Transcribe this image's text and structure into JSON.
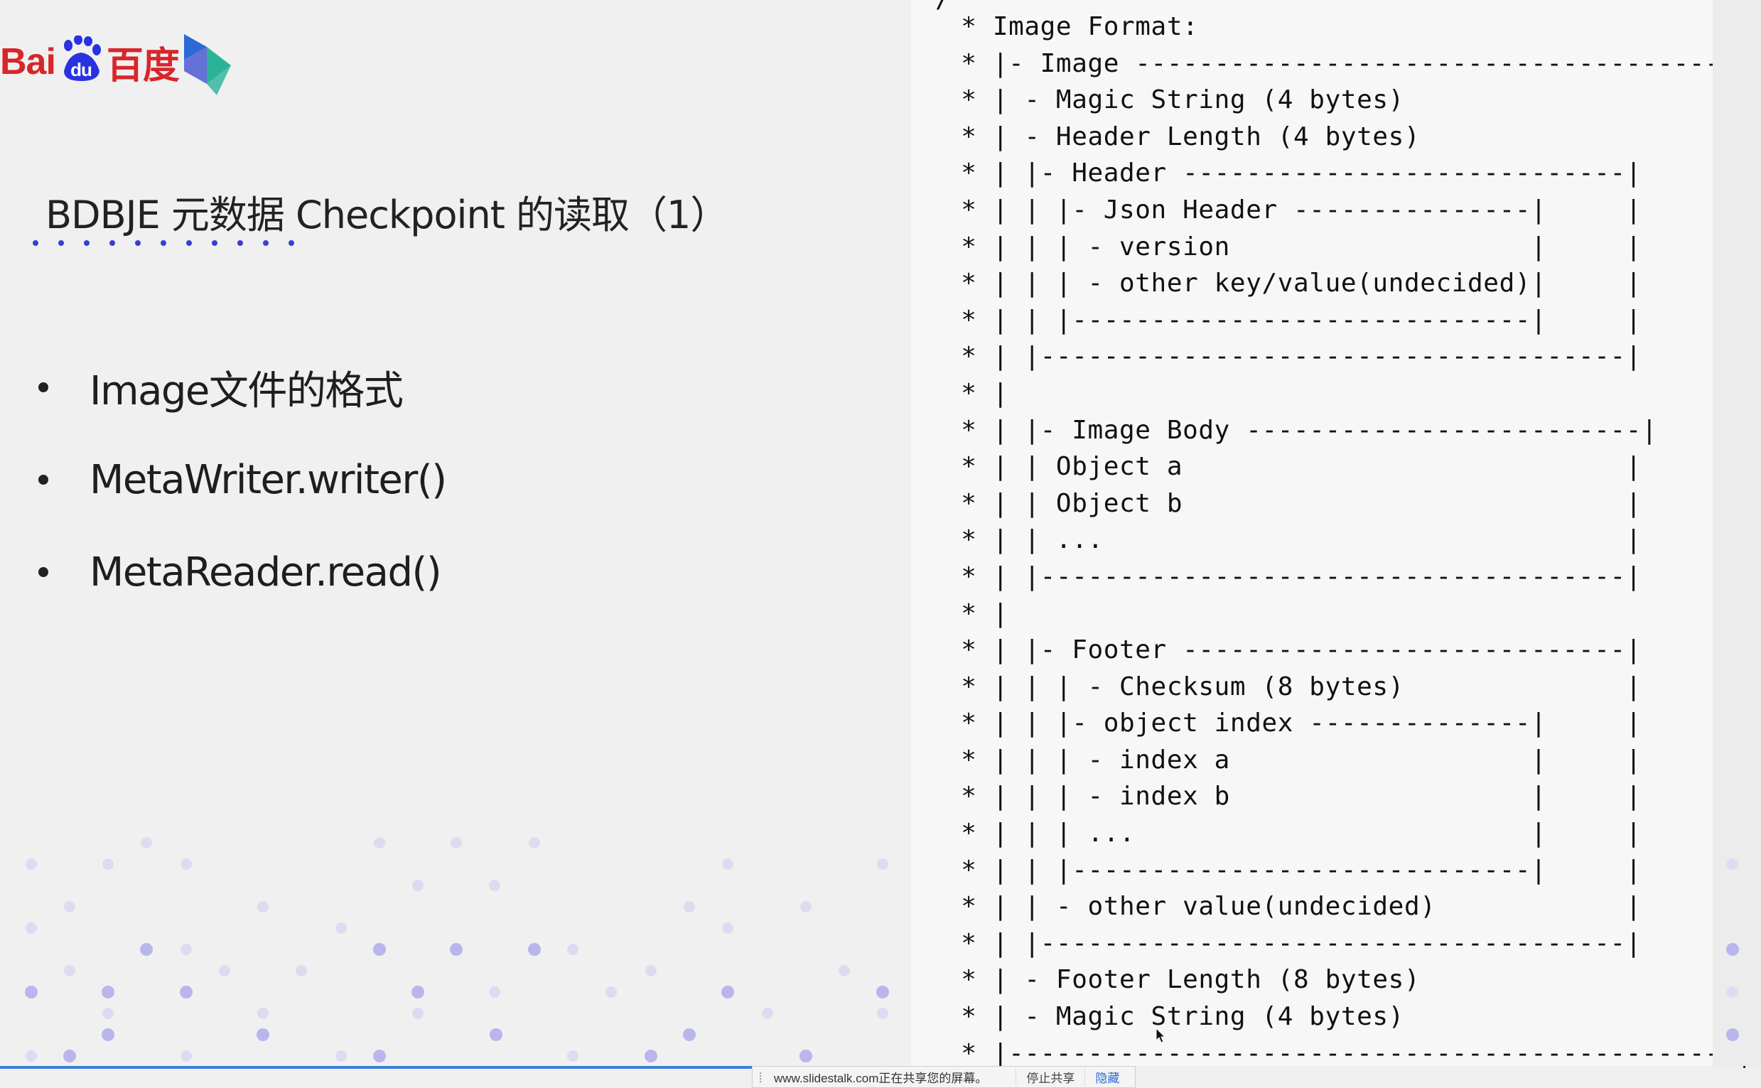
{
  "slide": {
    "brand": {
      "baidu_pre": "Bai",
      "baidu_du": "du",
      "baidu_cn": "百度"
    },
    "title": "BDBJE 元数据 Checkpoint 的读取（1）",
    "bullets": [
      "Image文件的格式",
      "MetaWriter.writer()",
      "MetaReader.read()"
    ]
  },
  "code": {
    "top_fragment": "/**",
    "lines": [
      " * Image Format:",
      " * |- Image --------------------------------------|",
      " * | - Magic String (4 bytes)                     |",
      " * | - Header Length (4 bytes)                    |",
      " * | |- Header ----------------------------|      |",
      " * | | |- Json Header ---------------|     |      |",
      " * | | | - version                   |     |      |",
      " * | | | - other key/value(undecided)|     |      |",
      " * | | |-----------------------------|     |      |",
      " * | |-------------------------------------|      |",
      " * |                                              |",
      " * | |- Image Body -------------------------|      |",
      " * | | Object a                            |      |",
      " * | | Object b                            |      |",
      " * | | ...                                 |      |",
      " * | |-------------------------------------|      |",
      " * |                                              |",
      " * | |- Footer ----------------------------|      |",
      " * | | | - Checksum (8 bytes)              |      |",
      " * | | |- object index --------------|     |      |",
      " * | | | - index a                   |     |      |",
      " * | | | - index b                   |     |      |",
      " * | | | ...                         |     |      |",
      " * | | |-----------------------------|     |      |",
      " * | | - other value(undecided)            |      |",
      " * | |-------------------------------------|      |",
      " * | - Footer Length (8 bytes)                    |",
      " * | - Magic String (4 bytes)                     |",
      " * |----------------------------------------------|"
    ]
  },
  "share_bar": {
    "message": "www.slidestalk.com正在共享您的屏幕。",
    "stop_label": "停止共享",
    "hide_label": "隐藏"
  },
  "colors": {
    "baidu_red": "#d7262b",
    "baidu_blue": "#2932e1",
    "accent_dots": "#3d3bd6",
    "share_link": "#2a6ed6"
  }
}
